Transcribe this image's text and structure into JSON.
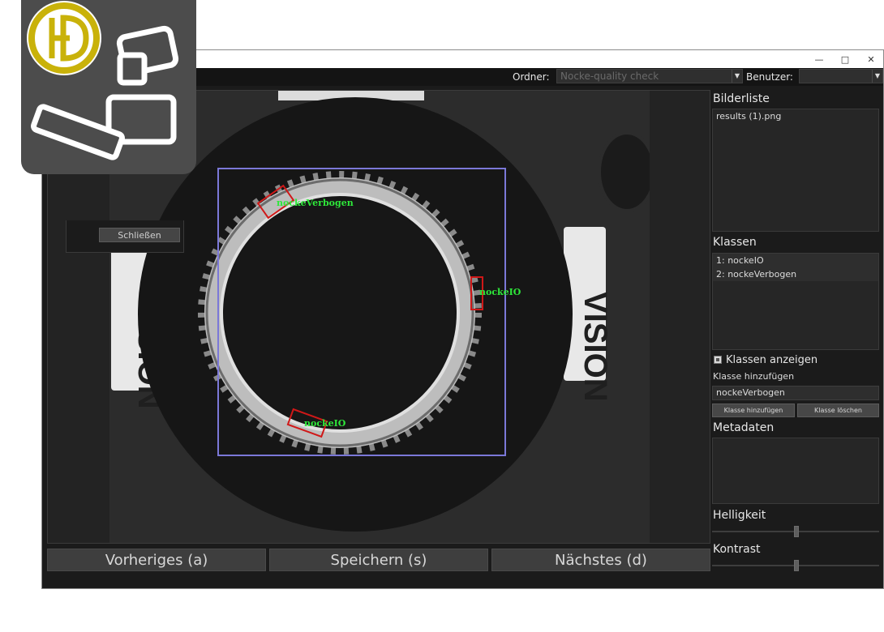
{
  "toolbar": {
    "folder_label": "Ordner:",
    "folder_value": "Nocke-quality check",
    "user_label": "Benutzer:",
    "user_value": ""
  },
  "dialog": {
    "close_label": "Schließen"
  },
  "navigation": {
    "prev_label": "Vorheriges (a)",
    "save_label": "Speichern (s)",
    "next_label": "Nächstes (d)"
  },
  "image_list": {
    "title": "Bilderliste",
    "items": [
      "results (1).png"
    ]
  },
  "classes": {
    "title": "Klassen",
    "items": [
      "1: nockeIO",
      "2: nockeVerbogen"
    ],
    "show_classes_label": "Klassen anzeigen",
    "show_classes_checked": true,
    "add_class_title": "Klasse hinzufügen",
    "add_class_value": "nockeVerbogen",
    "add_class_button": "Klasse hinzufügen",
    "delete_class_button": "Klasse löschen"
  },
  "metadata": {
    "title": "Metadaten"
  },
  "adjustments": {
    "brightness_label": "Helligkeit",
    "brightness_value": 0.5,
    "contrast_label": "Kontrast",
    "contrast_value": 0.5
  },
  "annotations": [
    {
      "label": "nockeVerbogen"
    },
    {
      "label": "nockeIO"
    },
    {
      "label": "nockeIO"
    }
  ],
  "photo_text": {
    "vision": "VISION"
  },
  "colors": {
    "annotation_text": "#2ee83a",
    "bbox_red": "#d01818",
    "selection_box": "#7b78d8",
    "logo_gold": "#c9b20a",
    "logo_tile": "#4c4c4c"
  }
}
